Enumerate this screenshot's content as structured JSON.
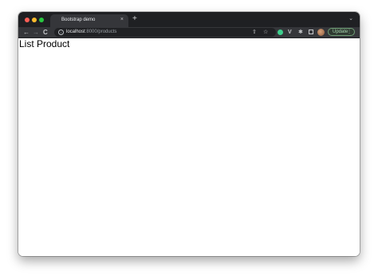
{
  "browser": {
    "tab": {
      "title": "Bootstrap demo",
      "close_glyph": "×"
    },
    "new_tab_glyph": "+",
    "tab_menu_glyph": "⌄",
    "nav": {
      "back_glyph": "←",
      "forward_glyph": "→",
      "reload_glyph": "C"
    },
    "address": {
      "host": "localhost",
      "path": ":8000/products"
    },
    "icons": {
      "info": "info-icon",
      "share": "share-icon",
      "bookmark": "star-icon",
      "extension_vpn": "vpn-extension-icon",
      "extension_v": "vue-devtools-icon",
      "extensions": "puzzle-icon",
      "side_panel": "side-panel-icon"
    },
    "update_label": "Update",
    "menu_glyph": "⋮",
    "colors": {
      "tabbar_bg": "#1f2023",
      "toolbar_bg": "#35363a",
      "update_text": "#a8d5b0",
      "close_dot": "#ff5f57",
      "minimize_dot": "#febc2e",
      "zoom_dot": "#28c840"
    }
  },
  "page": {
    "heading": "List Product"
  }
}
